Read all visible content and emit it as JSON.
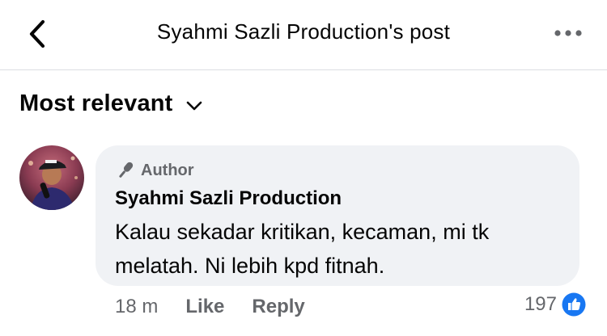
{
  "header": {
    "title": "Syahmi Sazli Production's post",
    "back_icon": "chevron-left-icon",
    "more_icon": "more-horizontal-icon"
  },
  "sort": {
    "label": "Most relevant",
    "icon": "chevron-down-icon"
  },
  "comment": {
    "badge_icon": "microphone-icon",
    "badge_label": "Author",
    "name": "Syahmi Sazli Production",
    "text": "Kalau sekadar kritikan, kecaman, mi tk melatah. Ni lebih kpd fitnah.",
    "time": "18 m",
    "like_label": "Like",
    "reply_label": "Reply",
    "reaction_count": "197",
    "reaction_icon": "like-reaction-icon"
  },
  "colors": {
    "bubble": "#f0f2f5",
    "secondary_text": "#65676b",
    "like_blue": "#1877f2",
    "divider": "#dcdee2"
  }
}
